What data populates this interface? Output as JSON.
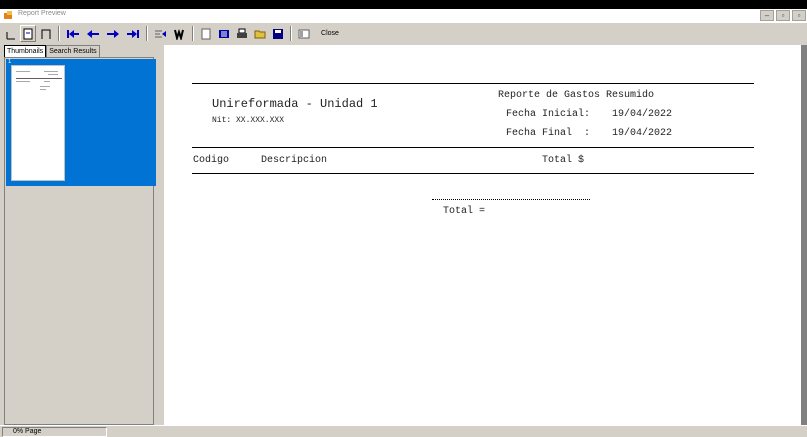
{
  "window": {
    "title": "Report Preview",
    "controls": [
      "minimize",
      "maximize",
      "restore"
    ]
  },
  "toolbar": {
    "close_label": "Close",
    "buttons": [
      "page-width-icon",
      "whole-page-icon",
      "two-pages-icon",
      "first-page-icon",
      "previous-page-icon",
      "next-page-icon",
      "last-page-icon",
      "go-to-page-icon",
      "find-icon",
      "new-icon",
      "print-setup-icon",
      "print-icon",
      "open-icon",
      "save-icon",
      "export-icon"
    ],
    "colors": {
      "arrow": "#0000c0",
      "print": "#0000a0"
    }
  },
  "left_pane": {
    "tabs": [
      {
        "label": "Thumbnails",
        "active": true
      },
      {
        "label": "Search Results",
        "active": false
      }
    ],
    "thumbnail": {
      "page_number": "1",
      "selection_color": "#0073d4"
    }
  },
  "report": {
    "company": "Unireformada - Unidad 1",
    "nit": "Nit: XX.XXX.XXX",
    "title": "Reporte de Gastos Resumido",
    "start_label": "Fecha Inicial:",
    "start_date": "19/04/2022",
    "end_label": "Fecha Final  :",
    "end_date": "19/04/2022",
    "columns": {
      "code": "Codigo",
      "description": "Descripcion",
      "total": "Total $"
    },
    "total_label": "Total ="
  },
  "status": {
    "text": "0% Page"
  }
}
